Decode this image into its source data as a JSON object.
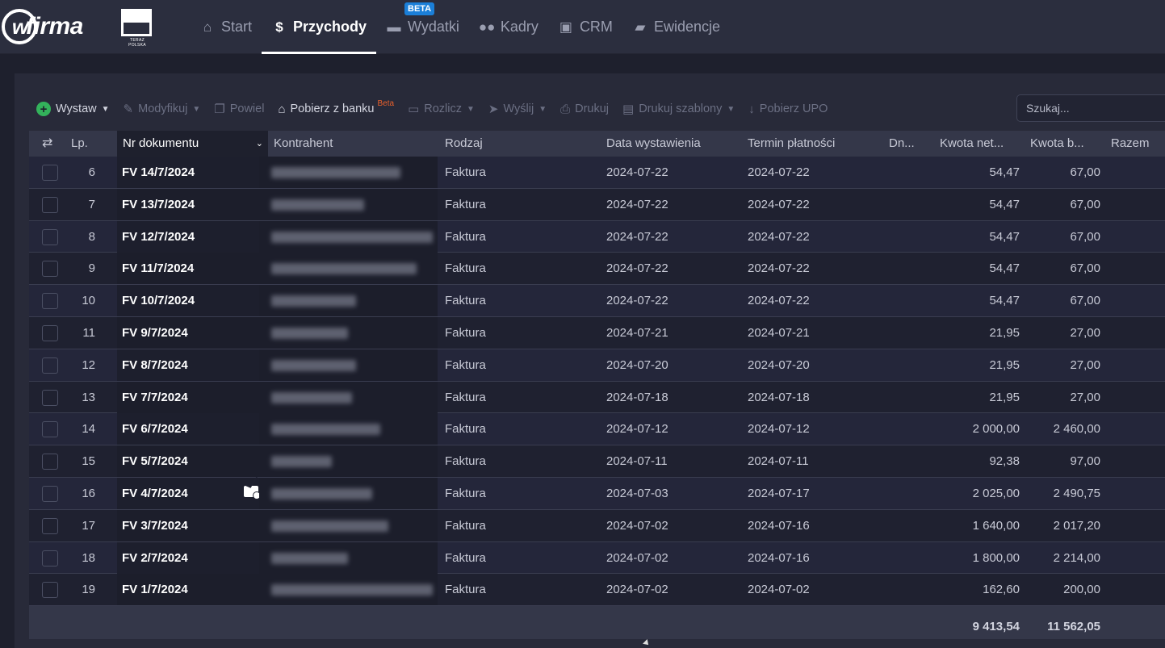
{
  "brand": {
    "logo_text": "firma",
    "logo_letter": "w",
    "partner_text": "TERAZ POLSKA"
  },
  "nav": {
    "items": [
      {
        "label": "Start",
        "icon": "home-icon"
      },
      {
        "label": "Przychody",
        "icon": "income-icon"
      },
      {
        "label": "Wydatki",
        "icon": "wallet-icon"
      },
      {
        "label": "Kadry",
        "icon": "users-icon"
      },
      {
        "label": "CRM",
        "icon": "contacts-icon"
      },
      {
        "label": "Ewidencje",
        "icon": "folder-icon"
      }
    ],
    "active": "Przychody",
    "crm_badge": "BETA"
  },
  "toolbar": {
    "issue": "Wystaw",
    "modify": "Modyfikuj",
    "repeat": "Powiel",
    "bank": "Pobierz z banku",
    "bank_badge": "Beta",
    "settle": "Rozlicz",
    "send": "Wyślij",
    "print": "Drukuj",
    "print_templates": "Drukuj szablony",
    "upo": "Pobierz UPO"
  },
  "search": {
    "placeholder": "Szukaj..."
  },
  "table": {
    "headers": {
      "lp": "Lp.",
      "doc": "Nr dokumentu",
      "contractor": "Kontrahent",
      "type": "Rodzaj",
      "issue_date": "Data wystawienia",
      "due_date": "Termin płatności",
      "days": "Dn...",
      "net": "Kwota net...",
      "gross": "Kwota b...",
      "total": "Razem"
    },
    "rows": [
      {
        "lp": "6",
        "doc": "FV 14/7/2024",
        "type": "Faktura",
        "issue": "2024-07-22",
        "due": "2024-07-22",
        "net": "54,47",
        "gross": "67,00"
      },
      {
        "lp": "7",
        "doc": "FV 13/7/2024",
        "type": "Faktura",
        "issue": "2024-07-22",
        "due": "2024-07-22",
        "net": "54,47",
        "gross": "67,00"
      },
      {
        "lp": "8",
        "doc": "FV 12/7/2024",
        "type": "Faktura",
        "issue": "2024-07-22",
        "due": "2024-07-22",
        "net": "54,47",
        "gross": "67,00"
      },
      {
        "lp": "9",
        "doc": "FV 11/7/2024",
        "type": "Faktura",
        "issue": "2024-07-22",
        "due": "2024-07-22",
        "net": "54,47",
        "gross": "67,00"
      },
      {
        "lp": "10",
        "doc": "FV 10/7/2024",
        "type": "Faktura",
        "issue": "2024-07-22",
        "due": "2024-07-22",
        "net": "54,47",
        "gross": "67,00"
      },
      {
        "lp": "11",
        "doc": "FV 9/7/2024",
        "type": "Faktura",
        "issue": "2024-07-21",
        "due": "2024-07-21",
        "net": "21,95",
        "gross": "27,00"
      },
      {
        "lp": "12",
        "doc": "FV 8/7/2024",
        "type": "Faktura",
        "issue": "2024-07-20",
        "due": "2024-07-20",
        "net": "21,95",
        "gross": "27,00"
      },
      {
        "lp": "13",
        "doc": "FV 7/7/2024",
        "type": "Faktura",
        "issue": "2024-07-18",
        "due": "2024-07-18",
        "net": "21,95",
        "gross": "27,00"
      },
      {
        "lp": "14",
        "doc": "FV 6/7/2024",
        "type": "Faktura",
        "issue": "2024-07-12",
        "due": "2024-07-12",
        "net": "2 000,00",
        "gross": "2 460,00"
      },
      {
        "lp": "15",
        "doc": "FV 5/7/2024",
        "type": "Faktura",
        "issue": "2024-07-11",
        "due": "2024-07-11",
        "net": "92,38",
        "gross": "97,00"
      },
      {
        "lp": "16",
        "doc": "FV 4/7/2024",
        "type": "Faktura",
        "issue": "2024-07-03",
        "due": "2024-07-17",
        "net": "2 025,00",
        "gross": "2 490,75",
        "mail": true
      },
      {
        "lp": "17",
        "doc": "FV 3/7/2024",
        "type": "Faktura",
        "issue": "2024-07-02",
        "due": "2024-07-16",
        "net": "1 640,00",
        "gross": "2 017,20"
      },
      {
        "lp": "18",
        "doc": "FV 2/7/2024",
        "type": "Faktura",
        "issue": "2024-07-02",
        "due": "2024-07-16",
        "net": "1 800,00",
        "gross": "2 214,00"
      },
      {
        "lp": "19",
        "doc": "FV 1/7/2024",
        "type": "Faktura",
        "issue": "2024-07-02",
        "due": "2024-07-02",
        "net": "162,60",
        "gross": "200,00"
      }
    ],
    "totals": {
      "net": "9 413,54",
      "gross": "11 562,05"
    }
  }
}
